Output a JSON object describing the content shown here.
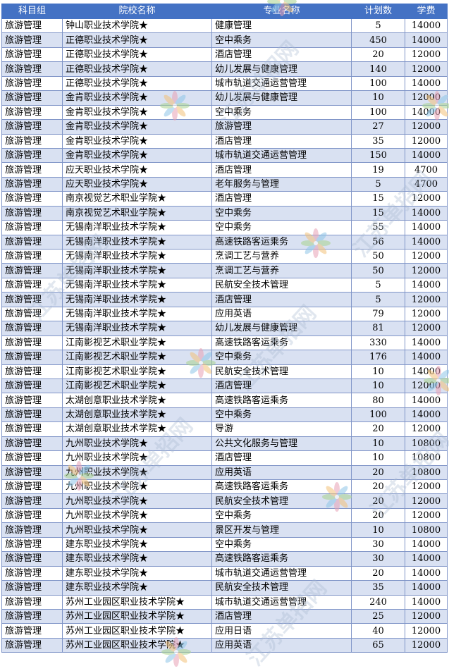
{
  "columns": [
    "科目组",
    "院校名称",
    "专业名称",
    "计划数",
    "学费"
  ],
  "rows": [
    [
      "旅游管理",
      "钟山职业技术学院★",
      "健康管理",
      "5",
      "14000"
    ],
    [
      "旅游管理",
      "正德职业技术学院★",
      "空中乘务",
      "450",
      "14000"
    ],
    [
      "旅游管理",
      "正德职业技术学院★",
      "酒店管理",
      "20",
      "12000"
    ],
    [
      "旅游管理",
      "正德职业技术学院★",
      "幼儿发展与健康管理",
      "140",
      "12000"
    ],
    [
      "旅游管理",
      "正德职业技术学院★",
      "城市轨道交通运营管理",
      "100",
      "14000"
    ],
    [
      "旅游管理",
      "金肯职业技术学院★",
      "幼儿发展与健康管理",
      "10",
      "12000"
    ],
    [
      "旅游管理",
      "金肯职业技术学院★",
      "空中乘务",
      "100",
      "14000"
    ],
    [
      "旅游管理",
      "金肯职业技术学院★",
      "旅游管理",
      "27",
      "12000"
    ],
    [
      "旅游管理",
      "金肯职业技术学院★",
      "酒店管理",
      "35",
      "12000"
    ],
    [
      "旅游管理",
      "金肯职业技术学院★",
      "城市轨道交通运营管理",
      "150",
      "14000"
    ],
    [
      "旅游管理",
      "应天职业技术学院★",
      "酒店管理",
      "19",
      "4700"
    ],
    [
      "旅游管理",
      "应天职业技术学院★",
      "老年服务与管理",
      "5",
      "4700"
    ],
    [
      "旅游管理",
      "南京视觉艺术职业学院★",
      "酒店管理",
      "15",
      "12000"
    ],
    [
      "旅游管理",
      "南京视觉艺术职业学院★",
      "空中乘务",
      "15",
      "14000"
    ],
    [
      "旅游管理",
      "无锡南洋职业技术学院★",
      "空中乘务",
      "55",
      "14000"
    ],
    [
      "旅游管理",
      "无锡南洋职业技术学院★",
      "高速铁路客运乘务",
      "56",
      "14000"
    ],
    [
      "旅游管理",
      "无锡南洋职业技术学院★",
      "烹调工艺与营养",
      "50",
      "12000"
    ],
    [
      "旅游管理",
      "无锡南洋职业技术学院★",
      "烹调工艺与营养",
      "50",
      "12000"
    ],
    [
      "旅游管理",
      "无锡南洋职业技术学院★",
      "民航安全技术管理",
      "5",
      "14000"
    ],
    [
      "旅游管理",
      "无锡南洋职业技术学院★",
      "酒店管理",
      "5",
      "12000"
    ],
    [
      "旅游管理",
      "无锡南洋职业技术学院★",
      "应用英语",
      "79",
      "12000"
    ],
    [
      "旅游管理",
      "无锡南洋职业技术学院★",
      "幼儿发展与健康管理",
      "81",
      "12000"
    ],
    [
      "旅游管理",
      "江南影视艺术职业学院★",
      "高速铁路客运乘务",
      "330",
      "14000"
    ],
    [
      "旅游管理",
      "江南影视艺术职业学院★",
      "空中乘务",
      "176",
      "14000"
    ],
    [
      "旅游管理",
      "江南影视艺术职业学院★",
      "民航安全技术管理",
      "10",
      "14000"
    ],
    [
      "旅游管理",
      "江南影视艺术职业学院★",
      "酒店管理",
      "10",
      "12000"
    ],
    [
      "旅游管理",
      "太湖创意职业技术学院★",
      "高速铁路客运乘务",
      "80",
      "14000"
    ],
    [
      "旅游管理",
      "太湖创意职业技术学院★",
      "空中乘务",
      "100",
      "14000"
    ],
    [
      "旅游管理",
      "太湖创意职业技术学院★",
      "导游",
      "20",
      "12000"
    ],
    [
      "旅游管理",
      "九州职业技术学院★",
      "公共文化服务与管理",
      "10",
      "10800"
    ],
    [
      "旅游管理",
      "九州职业技术学院★",
      "酒店管理",
      "10",
      "10800"
    ],
    [
      "旅游管理",
      "九州职业技术学院★",
      "应用英语",
      "20",
      "10800"
    ],
    [
      "旅游管理",
      "九州职业技术学院★",
      "高速铁路客运乘务",
      "20",
      "12000"
    ],
    [
      "旅游管理",
      "九州职业技术学院★",
      "民航安全技术管理",
      "20",
      "12000"
    ],
    [
      "旅游管理",
      "九州职业技术学院★",
      "空中乘务",
      "20",
      "12000"
    ],
    [
      "旅游管理",
      "九州职业技术学院★",
      "景区开发与管理",
      "10",
      "10800"
    ],
    [
      "旅游管理",
      "建东职业技术学院★",
      "空中乘务",
      "30",
      "14000"
    ],
    [
      "旅游管理",
      "建东职业技术学院★",
      "高速铁路客运乘务",
      "30",
      "14000"
    ],
    [
      "旅游管理",
      "建东职业技术学院★",
      "城市轨道交通运营管理",
      "20",
      "14000"
    ],
    [
      "旅游管理",
      "建东职业技术学院★",
      "民航安全技术管理",
      "35",
      "14000"
    ],
    [
      "旅游管理",
      "苏州工业园区职业技术学院★",
      "城市轨道交通运营管理",
      "240",
      "14000"
    ],
    [
      "旅游管理",
      "苏州工业园区职业技术学院★",
      "酒店管理",
      "25",
      "12000"
    ],
    [
      "旅游管理",
      "苏州工业园区职业技术学院★",
      "应用日语",
      "40",
      "12000"
    ],
    [
      "旅游管理",
      "苏州工业园区职业技术学院★",
      "应用英语",
      "65",
      "12000"
    ]
  ],
  "watermark": {
    "text": "江苏单招网",
    "logo_icon": "pinwheel-logo-icon",
    "colors": [
      "#e8a2b6",
      "#8fc6e8",
      "#a8d38f",
      "#f3c27a"
    ]
  }
}
